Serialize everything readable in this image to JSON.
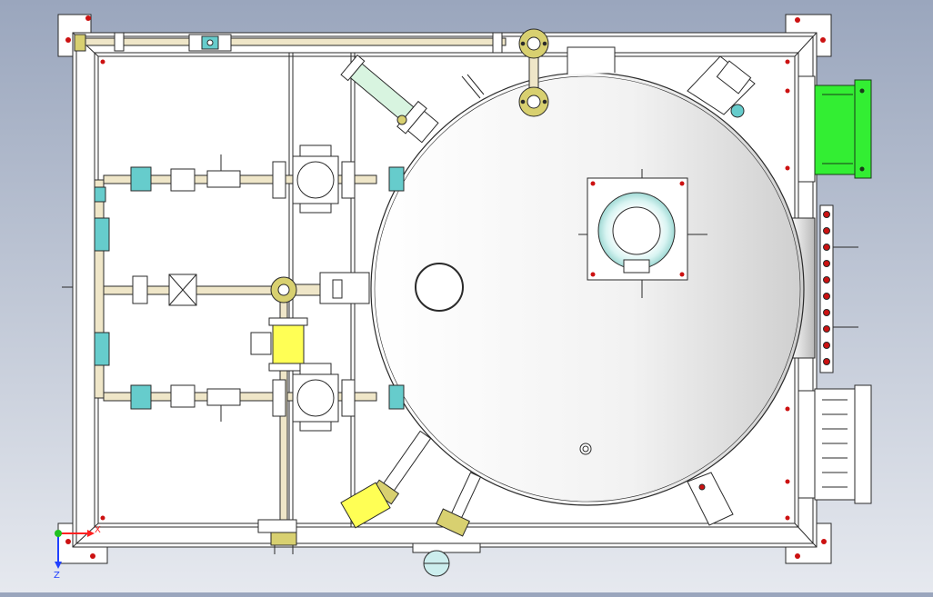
{
  "view": {
    "background_top": "#9aa6bd",
    "background_bottom": "#e6e9ef"
  },
  "triad": {
    "x_label": "X",
    "z_label": "Z",
    "x_color": "#ff2020",
    "y_color": "#20c020",
    "z_color": "#2040ff"
  },
  "colors": {
    "frame": "#ffffff",
    "stroke": "#2a2a2a",
    "pipe": "#efe6c8",
    "valve_yellow": "#ffff55",
    "motor_green": "#33ee33",
    "fitting_cyan": "#66cccc",
    "flange_olive": "#d8d070",
    "bolt_red": "#cc1111",
    "port_cyan": "#cceeee"
  }
}
